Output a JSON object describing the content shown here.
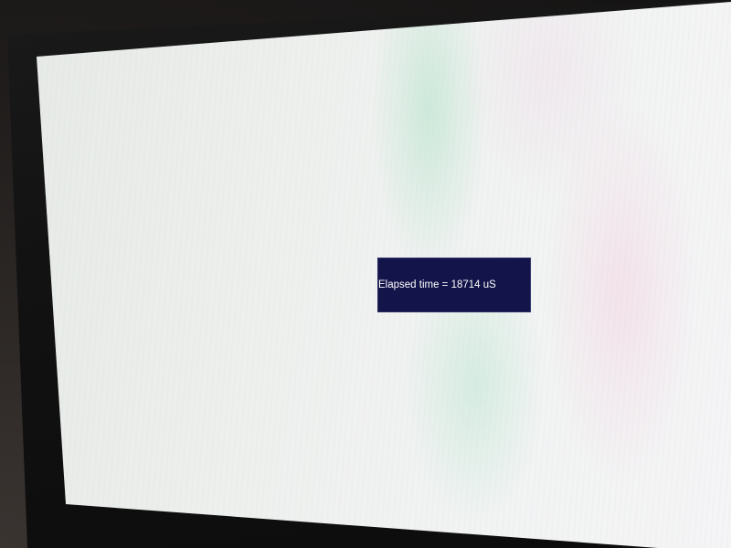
{
  "display": {
    "message": "Elapsed time = 18714 uS"
  },
  "colors": {
    "box_background": "#13144a",
    "box_text": "#ffffff",
    "screen_background": "#eef0ee"
  }
}
